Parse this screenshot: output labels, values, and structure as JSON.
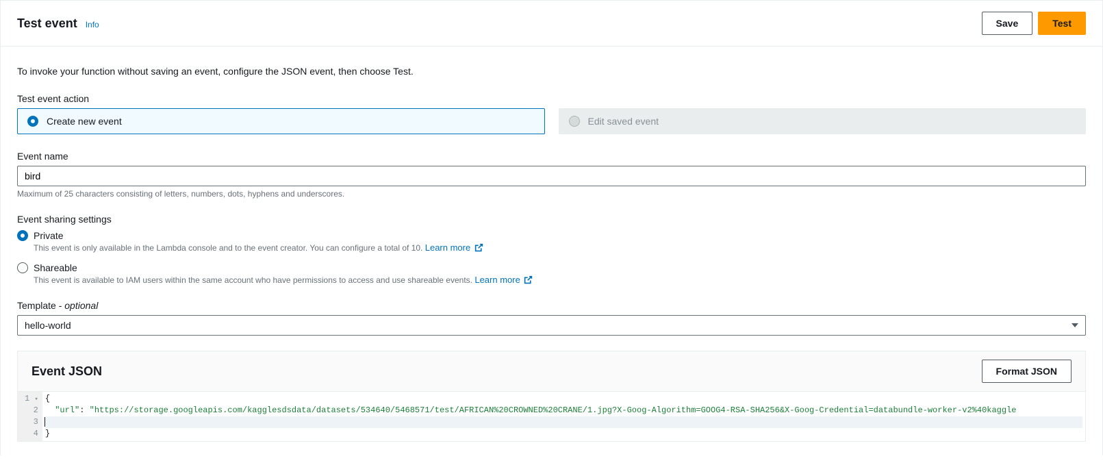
{
  "header": {
    "title": "Test event",
    "info": "Info",
    "save": "Save",
    "test": "Test"
  },
  "description": "To invoke your function without saving an event, configure the JSON event, then choose Test.",
  "action": {
    "label": "Test event action",
    "create": "Create new event",
    "edit": "Edit saved event"
  },
  "eventName": {
    "label": "Event name",
    "value": "bird",
    "hint": "Maximum of 25 characters consisting of letters, numbers, dots, hyphens and underscores."
  },
  "sharing": {
    "label": "Event sharing settings",
    "private": {
      "label": "Private",
      "desc": "This event is only available in the Lambda console and to the event creator. You can configure a total of 10.",
      "learn": "Learn more"
    },
    "shareable": {
      "label": "Shareable",
      "desc": "This event is available to IAM users within the same account who have permissions to access and use shareable events.",
      "learn": "Learn more"
    }
  },
  "template": {
    "label_prefix": "Template",
    "label_suffix": " - ",
    "optional": "optional",
    "value": "hello-world"
  },
  "json": {
    "title": "Event JSON",
    "format": "Format JSON",
    "gutter": [
      "1",
      "2",
      "3",
      "4"
    ],
    "lines": {
      "l1": "{",
      "l2_key": "\"url\"",
      "l2_colon": ": ",
      "l2_val": "\"https://storage.googleapis.com/kagglesdsdata/datasets/534640/5468571/test/AFRICAN%20CROWNED%20CRANE/1.jpg?X-Goog-Algorithm=GOOG4-RSA-SHA256&X-Goog-Credential=databundle-worker-v2%40kaggle",
      "l3": "",
      "l4": "}"
    }
  }
}
